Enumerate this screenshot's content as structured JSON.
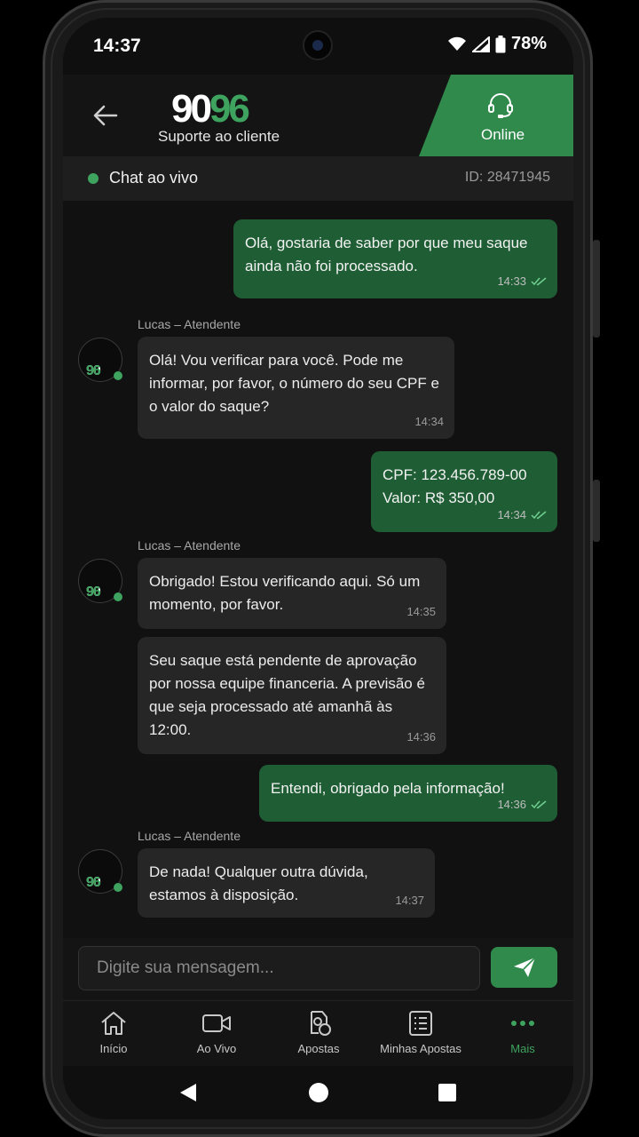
{
  "status": {
    "time": "14:37",
    "battery": "78%"
  },
  "header": {
    "logo_a": "90",
    "logo_b": "96",
    "subtitle": "Suporte ao cliente",
    "online_label": "Online"
  },
  "livebar": {
    "label": "Chat ao vivo",
    "chat_id": "ID: 28471945"
  },
  "agent": {
    "sender": "Lucas – Atendente",
    "logo_a": "90",
    "logo_b": "96"
  },
  "messages": {
    "m1": {
      "text": "Olá, gostaria de saber por que meu saque ainda não foi processado.",
      "time": "14:33"
    },
    "m2": {
      "text": "Olá! Vou verificar para você. Pode me informar, por favor, o número do seu CPF e o valor do saque?",
      "time": "14:34"
    },
    "m3": {
      "line1": "CPF: 123.456.789-00",
      "line2": "Valor: R$ 350,00",
      "time": "14:34"
    },
    "m4": {
      "text": "Obrigado! Estou verificando aqui. Só um momento, por favor.",
      "time": "14:35"
    },
    "m5": {
      "text": "Seu saque está pendente de aprovação por nossa equipe financeria. A previsão é que seja processado até amanhã às 12:00.",
      "time": "14:36"
    },
    "m6": {
      "text": "Entendi, obrigado pela informação!",
      "time": "14:36"
    },
    "m7": {
      "text": "De nada! Qualquer outra dúvida, estamos à disposição.",
      "time": "14:37"
    }
  },
  "composer": {
    "placeholder": "Digite sua mensagem..."
  },
  "nav": {
    "items": [
      {
        "label": "Início",
        "icon": "home-icon"
      },
      {
        "label": "Ao Vivo",
        "icon": "video-icon"
      },
      {
        "label": "Apostas",
        "icon": "bets-icon"
      },
      {
        "label": "Minhas Apostas",
        "icon": "list-icon"
      },
      {
        "label": "Mais",
        "icon": "more-icon"
      }
    ],
    "active_color": "#3ea35f"
  },
  "colors": {
    "brand_green": "#2f8a4c",
    "outgoing_bubble": "#1f5e35",
    "incoming_bubble": "#262626"
  }
}
